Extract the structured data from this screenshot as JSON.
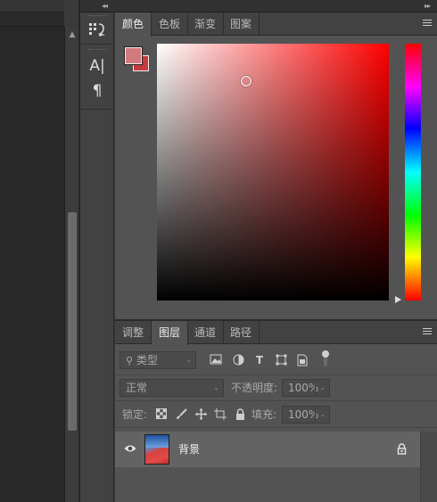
{
  "color_panel": {
    "tabs": [
      "颜色",
      "色板",
      "渐变",
      "图案"
    ],
    "active_tab": "颜色",
    "foreground_color": "#d37a7f",
    "background_color": "#c53a3d",
    "hue_color": "#ff0000"
  },
  "layers_panel": {
    "tabs": [
      "调整",
      "图层",
      "通道",
      "路径"
    ],
    "active_tab": "图层",
    "filter": {
      "placeholder": "类型"
    },
    "blend_mode": "正常",
    "opacity_label": "不透明度:",
    "opacity_value": "100%",
    "lock_label": "锁定:",
    "fill_label": "填充:",
    "fill_value": "100%",
    "layers": [
      {
        "name": "背景",
        "visible": true,
        "locked": true
      }
    ]
  },
  "icons": {
    "dock": [
      "paragraph-layout-icon",
      "character-icon",
      "pilcrow-icon"
    ],
    "filter_kinds": [
      "image-filter-icon",
      "adjustment-filter-icon",
      "type-filter-icon",
      "shape-filter-icon",
      "smart-object-filter-icon",
      "filter-toggle-icon"
    ],
    "lock": [
      "lock-pixels-icon",
      "lock-paint-icon",
      "lock-position-icon",
      "lock-artboard-icon",
      "lock-all-icon"
    ]
  }
}
